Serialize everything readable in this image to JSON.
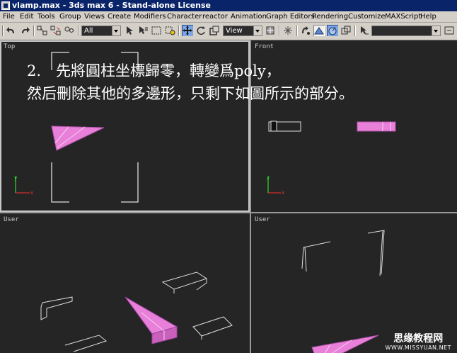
{
  "window": {
    "title": "vlamp.max - 3ds max 6 - Stand-alone License"
  },
  "menu": [
    "File",
    "Edit",
    "Tools",
    "Group",
    "Views",
    "Create",
    "Modifiers",
    "Character",
    "reactor",
    "Animation",
    "Graph Editors",
    "Rendering",
    "Customize",
    "MAXScript",
    "Help"
  ],
  "toolbar": {
    "selection_filter": "All",
    "reference_coord": "View",
    "named_selection": "",
    "icons": [
      "undo-icon",
      "redo-icon",
      "select-link-icon",
      "unlink-icon",
      "bind-space-warp-icon",
      "select-object-icon",
      "select-by-name-icon",
      "rect-selection-icon",
      "window-crossing-icon",
      "move-icon",
      "rotate-icon",
      "scale-icon",
      "pivot-center-icon",
      "mirror-icon",
      "align-icon",
      "normal-align-icon",
      "place-highlight-icon",
      "named-selection-icon"
    ]
  },
  "viewports": {
    "top": {
      "label": "Top"
    },
    "front": {
      "label": "Front"
    },
    "user_left": {
      "label": "User"
    },
    "user_right": {
      "label": "User"
    }
  },
  "annotation": {
    "line1": "2.　先將圓柱坐標歸零，轉變爲poly，",
    "line2": "然后刪除其他的多邊形，只剩下如圖所示的部分。"
  },
  "watermark": {
    "line1": "思缘教程网",
    "line2": "WWW.MISSYUAN.NET"
  },
  "colors": {
    "viewport_bg": "#252525",
    "selected_mesh": "#e87fd8",
    "active_tool": "#7aa6e8",
    "axis_x": "#ff3030",
    "axis_y": "#30ff30"
  }
}
